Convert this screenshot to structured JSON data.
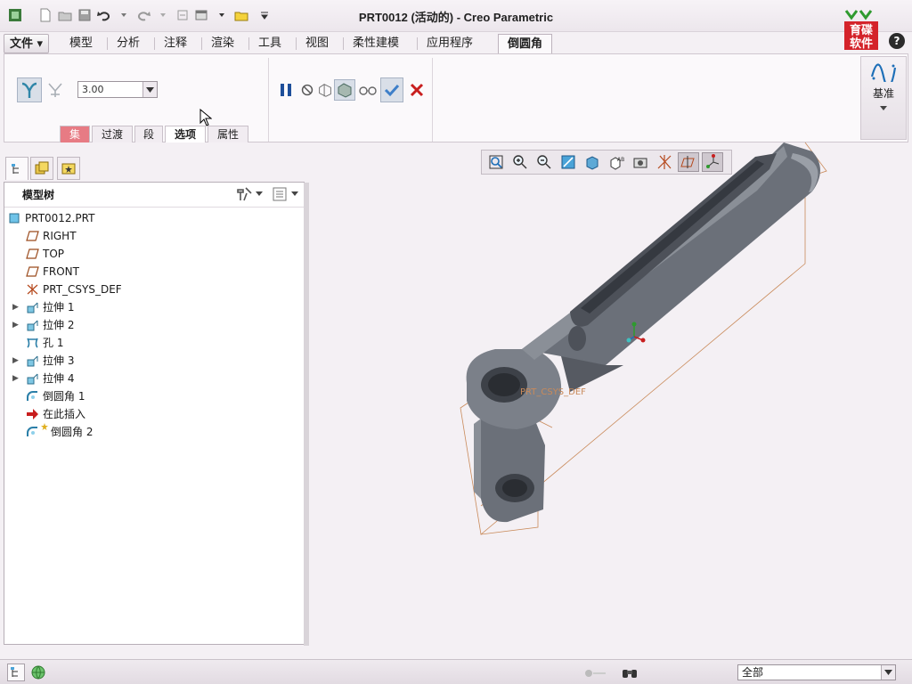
{
  "window": {
    "title": "PRT0012 (活动的) - Creo Parametric"
  },
  "ribbon_tabs": [
    {
      "label": "文件"
    },
    {
      "label": "模型"
    },
    {
      "label": "分析"
    },
    {
      "label": "注释"
    },
    {
      "label": "渲染"
    },
    {
      "label": "工具"
    },
    {
      "label": "视图"
    },
    {
      "label": "柔性建模"
    },
    {
      "label": "应用程序"
    },
    {
      "label": "倒圆角"
    }
  ],
  "round_tool": {
    "radius_value": "3.00",
    "sub_tabs": [
      {
        "label": "集"
      },
      {
        "label": "过渡"
      },
      {
        "label": "段"
      },
      {
        "label": "选项"
      },
      {
        "label": "属性"
      }
    ],
    "datum_label": "基准"
  },
  "model_tree": {
    "header": "模型树",
    "items": [
      {
        "label": "PRT0012.PRT",
        "icon": "part-icon",
        "expandable": false
      },
      {
        "label": "RIGHT",
        "icon": "datum-plane-icon",
        "expandable": false
      },
      {
        "label": "TOP",
        "icon": "datum-plane-icon",
        "expandable": false
      },
      {
        "label": "FRONT",
        "icon": "datum-plane-icon",
        "expandable": false
      },
      {
        "label": "PRT_CSYS_DEF",
        "icon": "csys-icon",
        "expandable": false
      },
      {
        "label": "拉伸 1",
        "icon": "extrude-icon",
        "expandable": true
      },
      {
        "label": "拉伸 2",
        "icon": "extrude-icon",
        "expandable": true
      },
      {
        "label": "孔 1",
        "icon": "hole-icon",
        "expandable": false
      },
      {
        "label": "拉伸 3",
        "icon": "extrude-icon",
        "expandable": true
      },
      {
        "label": "拉伸 4",
        "icon": "extrude-icon",
        "expandable": true
      },
      {
        "label": "倒圆角 1",
        "icon": "round-icon",
        "expandable": false
      },
      {
        "label": "在此插入",
        "icon": "insert-arrow-icon",
        "expandable": false
      },
      {
        "label": "倒圆角 2",
        "icon": "round-new-icon",
        "expandable": false
      }
    ]
  },
  "viewport": {
    "csys_label": "PRT_CSYS_DEF"
  },
  "statusbar": {
    "filter_value": "全部"
  },
  "brand": {
    "logo_text_1": "育碟",
    "logo_text_2": "软件"
  },
  "colors": {
    "highlight_tab": "#e77b84",
    "model_gray": "#6b7079",
    "confirm_blue": "#3e7fc9",
    "cancel_red": "#c81e1e"
  }
}
